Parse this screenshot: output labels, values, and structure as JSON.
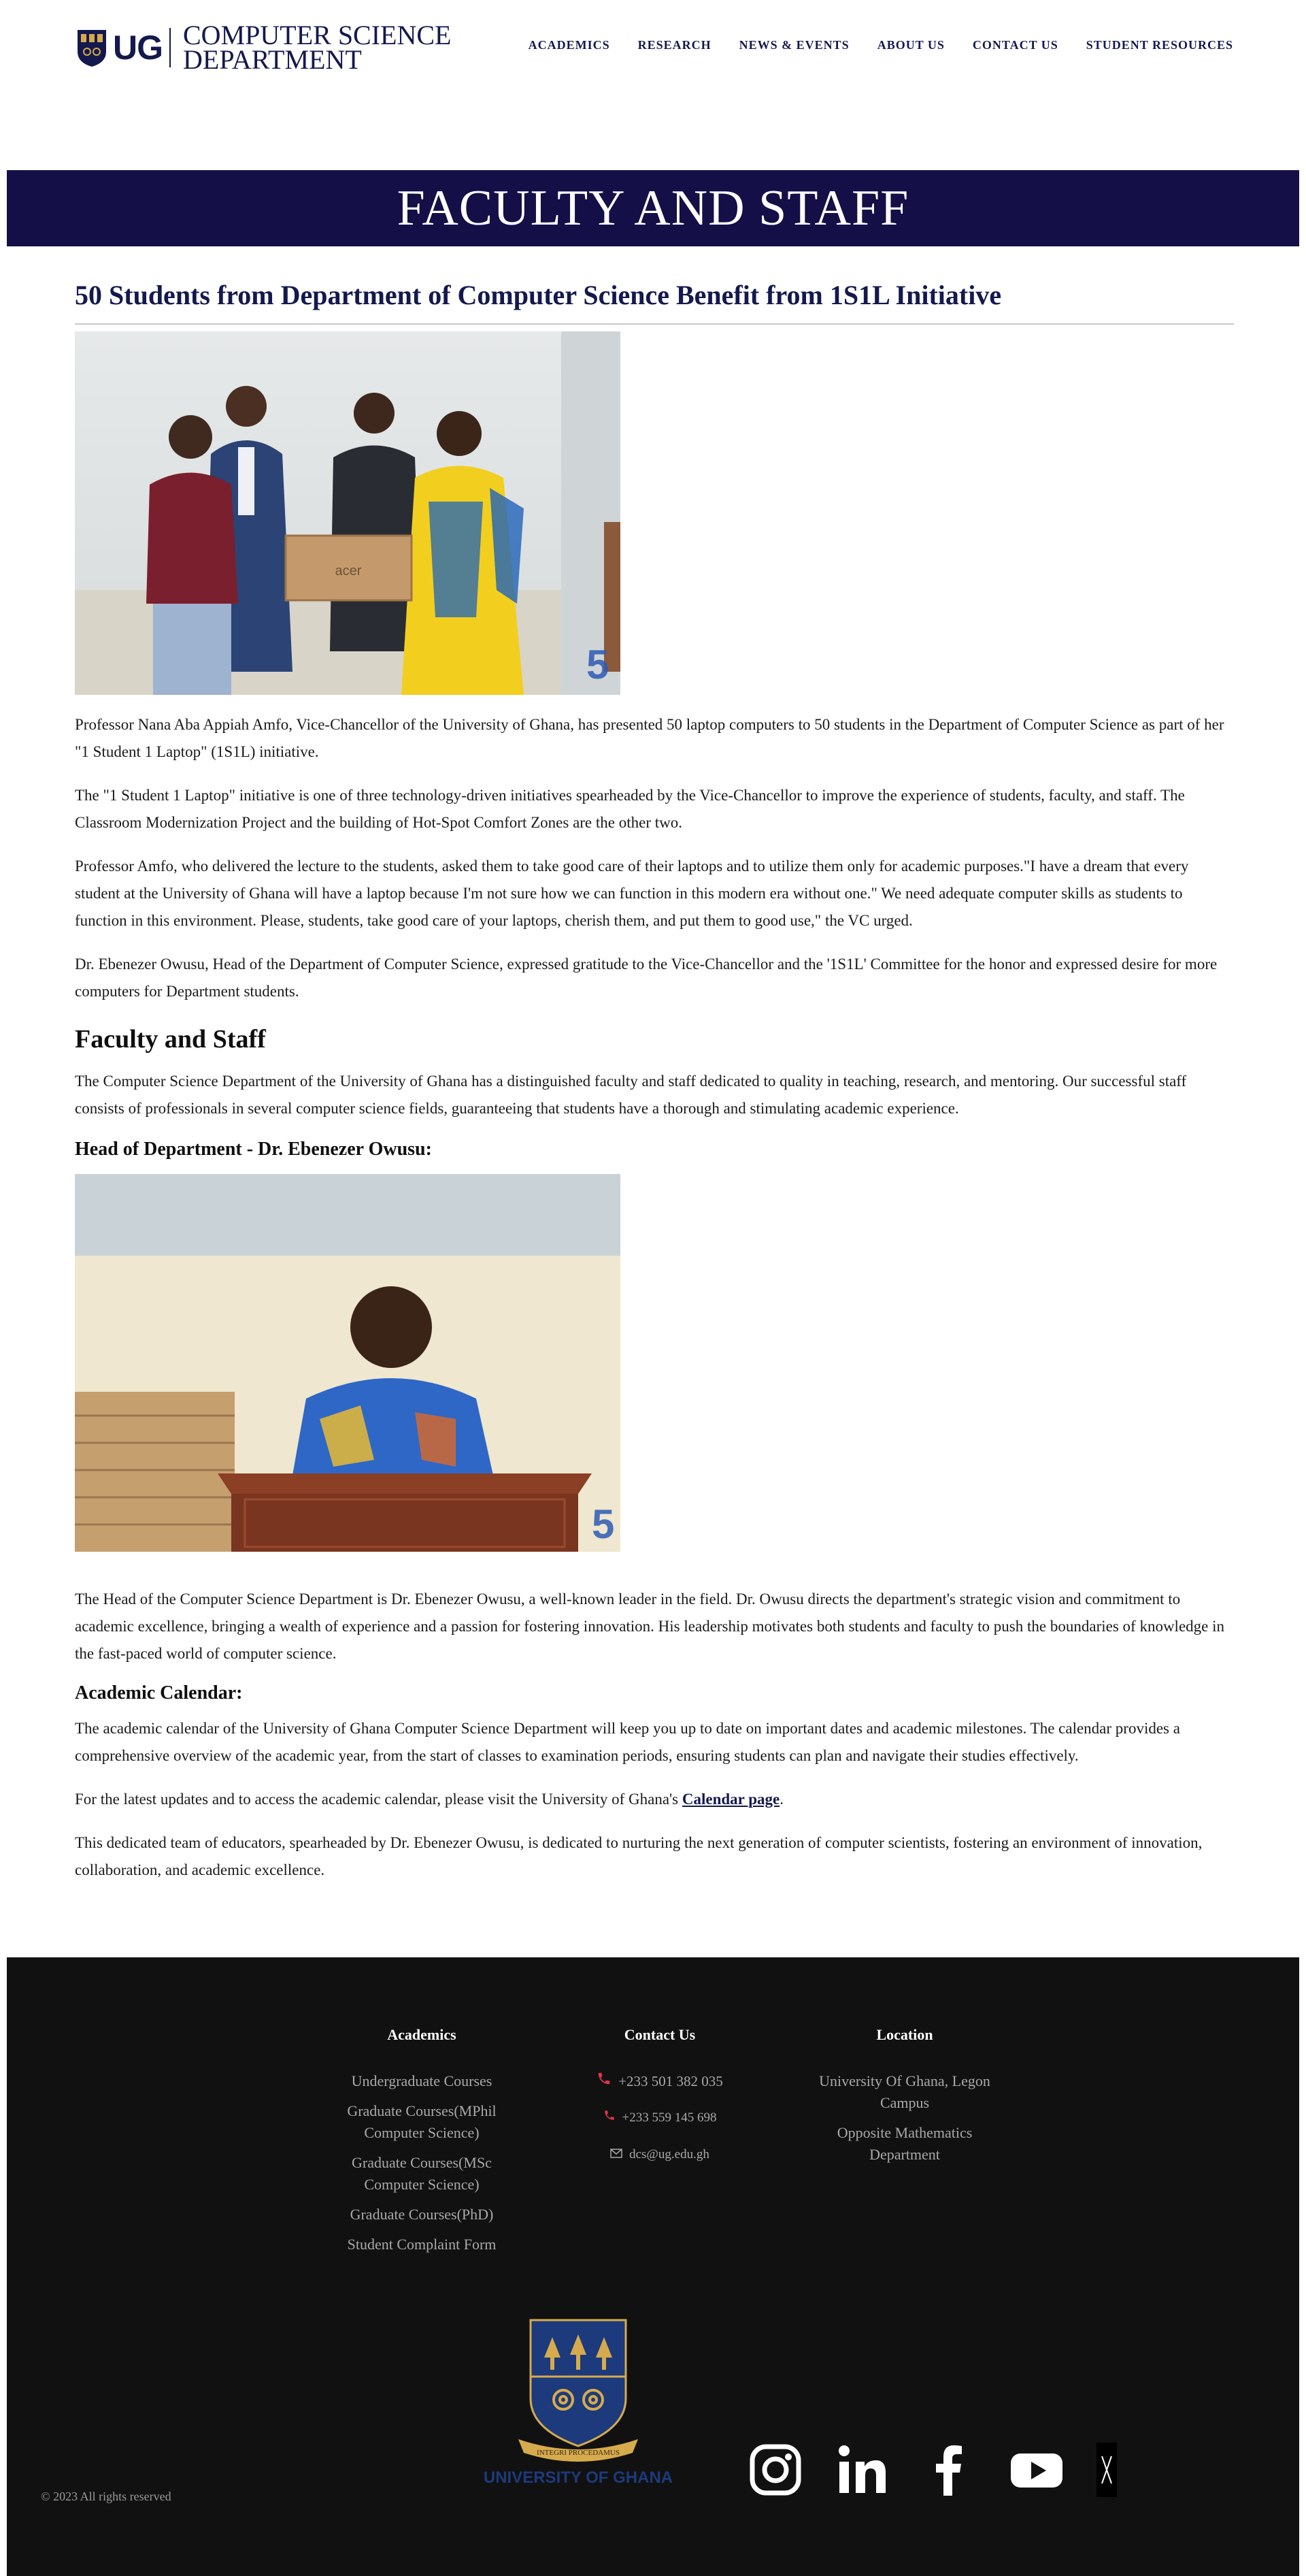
{
  "header": {
    "logo_text": "UG",
    "dept_line1": "COMPUTER SCIENCE",
    "dept_line2": "DEPARTMENT",
    "nav": [
      "ACADEMICS",
      "RESEARCH",
      "NEWS & EVENTS",
      "ABOUT US",
      "CONTACT US",
      "STUDENT RESOURCES"
    ]
  },
  "banner": {
    "title": "FACULTY AND STAFF"
  },
  "article": {
    "title": "50 Students from Department of Computer Science Benefit from 1S1L Initiative",
    "laptop_brand": "acer",
    "paragraphs": [
      "Professor Nana Aba Appiah Amfo, Vice-Chancellor of the University of Ghana, has presented 50 laptop computers to 50 students in the Department of Computer Science as part of her \"1 Student 1 Laptop\" (1S1L) initiative.",
      "The \"1 Student 1 Laptop\" initiative is one of three technology-driven initiatives spearheaded by the Vice-Chancellor to improve the experience of students, faculty, and staff. The Classroom Modernization Project and the building of Hot-Spot Comfort Zones are the other two.",
      "Professor Amfo, who delivered the lecture to the students, asked them to take good care of their laptops and to utilize them only for academic purposes.\"I have a dream that every student at the University of Ghana will have a laptop because I'm not sure how we can function in this modern era without one.\" We need adequate computer skills as students to function in this environment. Please, students, take good care of your laptops, cherish them, and put them to good use,\" the VC urged.",
      "Dr. Ebenezer Owusu, Head of the Department of Computer Science, expressed gratitude to the Vice-Chancellor and the '1S1L' Committee for the honor and expressed desire for more computers for Department students."
    ]
  },
  "faculty": {
    "heading": "Faculty and Staff",
    "intro": "The Computer Science Department of the University of Ghana has a distinguished faculty and staff dedicated to quality in teaching, research, and mentoring. Our successful staff consists of professionals in several computer science fields, guaranteeing that students have a thorough and stimulating academic experience.",
    "hod_heading": "Head of Department - Dr. Ebenezer Owusu:",
    "hod_text": "The Head of the Computer Science Department is Dr. Ebenezer Owusu, a well-known leader in the field. Dr. Owusu directs the department's strategic vision and commitment to academic excellence, bringing a wealth of experience and a passion for fostering innovation. His leadership motivates both students and faculty to push the boundaries of knowledge in the fast-paced world of computer science.",
    "calendar_heading": "Academic Calendar:",
    "calendar_text": "The academic calendar of the University of Ghana Computer Science Department will keep you up to date on important dates and academic milestones. The calendar provides a comprehensive overview of the academic year, from the start of classes to examination periods, ensuring students can plan and navigate their studies effectively.",
    "calendar_link_prefix": "For the latest updates and to access the academic calendar, please visit the University of Ghana's ",
    "calendar_link_label": "Calendar page",
    "calendar_link_suffix": ".",
    "closing_text": "This dedicated team of educators, spearheaded by Dr. Ebenezer Owusu, is dedicated to nurturing the next generation of computer scientists, fostering an environment of innovation, collaboration, and academic excellence."
  },
  "footer": {
    "academics": {
      "heading": "Academics",
      "links": [
        "Undergraduate Courses",
        "Graduate Courses(MPhil Computer Science)",
        "Graduate Courses(MSc Computer Science)",
        "Graduate Courses(PhD)",
        "Student Complaint Form"
      ]
    },
    "contact": {
      "heading": "Contact Us",
      "phone1": "+233 501 382 035",
      "phone2": "+233 559 145 698",
      "email": "dcs@ug.edu.gh"
    },
    "location": {
      "heading": "Location",
      "line1": "University Of Ghana, Legon Campus",
      "line2": "Opposite Mathematics Department"
    },
    "crest_motto": "INTEGRI PROCEDAMUS",
    "university_name": "UNIVERSITY OF GHANA",
    "social": [
      "instagram-icon",
      "linkedin-icon",
      "facebook-icon",
      "youtube-icon",
      "x-icon"
    ],
    "copyright": "© 2023 All rights reserved"
  },
  "colors": {
    "navy": "#14194d",
    "banner": "#140f47",
    "footer_bg": "#111111",
    "gold": "#d6ab4d",
    "phone_red": "#e0344a"
  }
}
